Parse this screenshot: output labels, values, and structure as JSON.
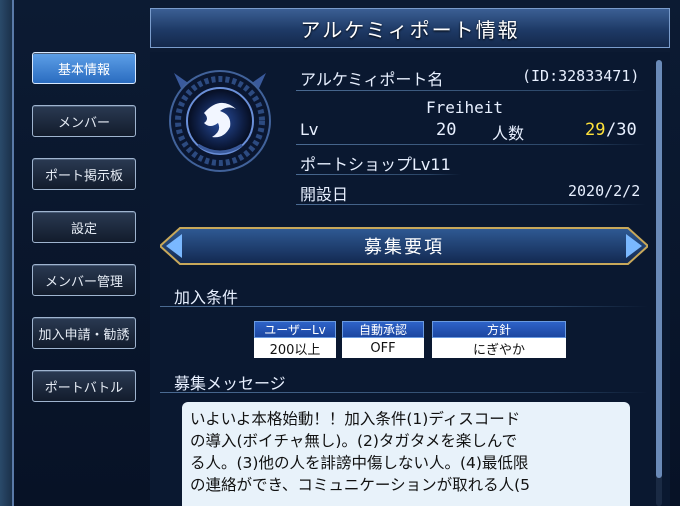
{
  "title": "アルケミィポート情報",
  "sidebar": {
    "items": [
      {
        "label": "基本情報",
        "active": true
      },
      {
        "label": "メンバー",
        "active": false
      },
      {
        "label": "ポート掲示板",
        "active": false
      },
      {
        "label": "設定",
        "active": false
      },
      {
        "label": "メンバー管理",
        "active": false
      },
      {
        "label": "加入申請・勧誘",
        "active": false
      },
      {
        "label": "ポートバトル",
        "active": false
      }
    ]
  },
  "info": {
    "port_name_label": "アルケミィポート名",
    "id_text": "(ID:32833471)",
    "port_name": "Freiheit",
    "lv_label": "Lv",
    "lv_value": "20",
    "members_label": "人数",
    "members_current": "29",
    "members_max": "/30",
    "shop_label": "ポートショップLv11",
    "founded_label": "開設日",
    "founded_value": "2020/2/2"
  },
  "recruit": {
    "banner": "募集要項",
    "conditions_heading": "加入条件",
    "conditions": [
      {
        "header": "ユーザーLv",
        "value": "200以上"
      },
      {
        "header": "自動承認",
        "value": "OFF"
      },
      {
        "header": "方針",
        "value": "にぎやか"
      }
    ],
    "message_heading": "募集メッセージ",
    "message_lines": [
      "いよいよ本格始動！！加入条件(1)ディスコード",
      "の導入(ボイチャ無し)。(2)タガタメを楽しんで",
      "る人。(3)他の人を誹謗中傷しない人。(4)最低限",
      "の連絡ができ、コミュニケーションが取れる人(5"
    ]
  },
  "colors": {
    "accent_blue": "#2a6cc0",
    "highlight_yellow": "#ffe23a",
    "panel_bg": "#0a1830"
  },
  "icons": {
    "emblem": "port-emblem-icon"
  }
}
